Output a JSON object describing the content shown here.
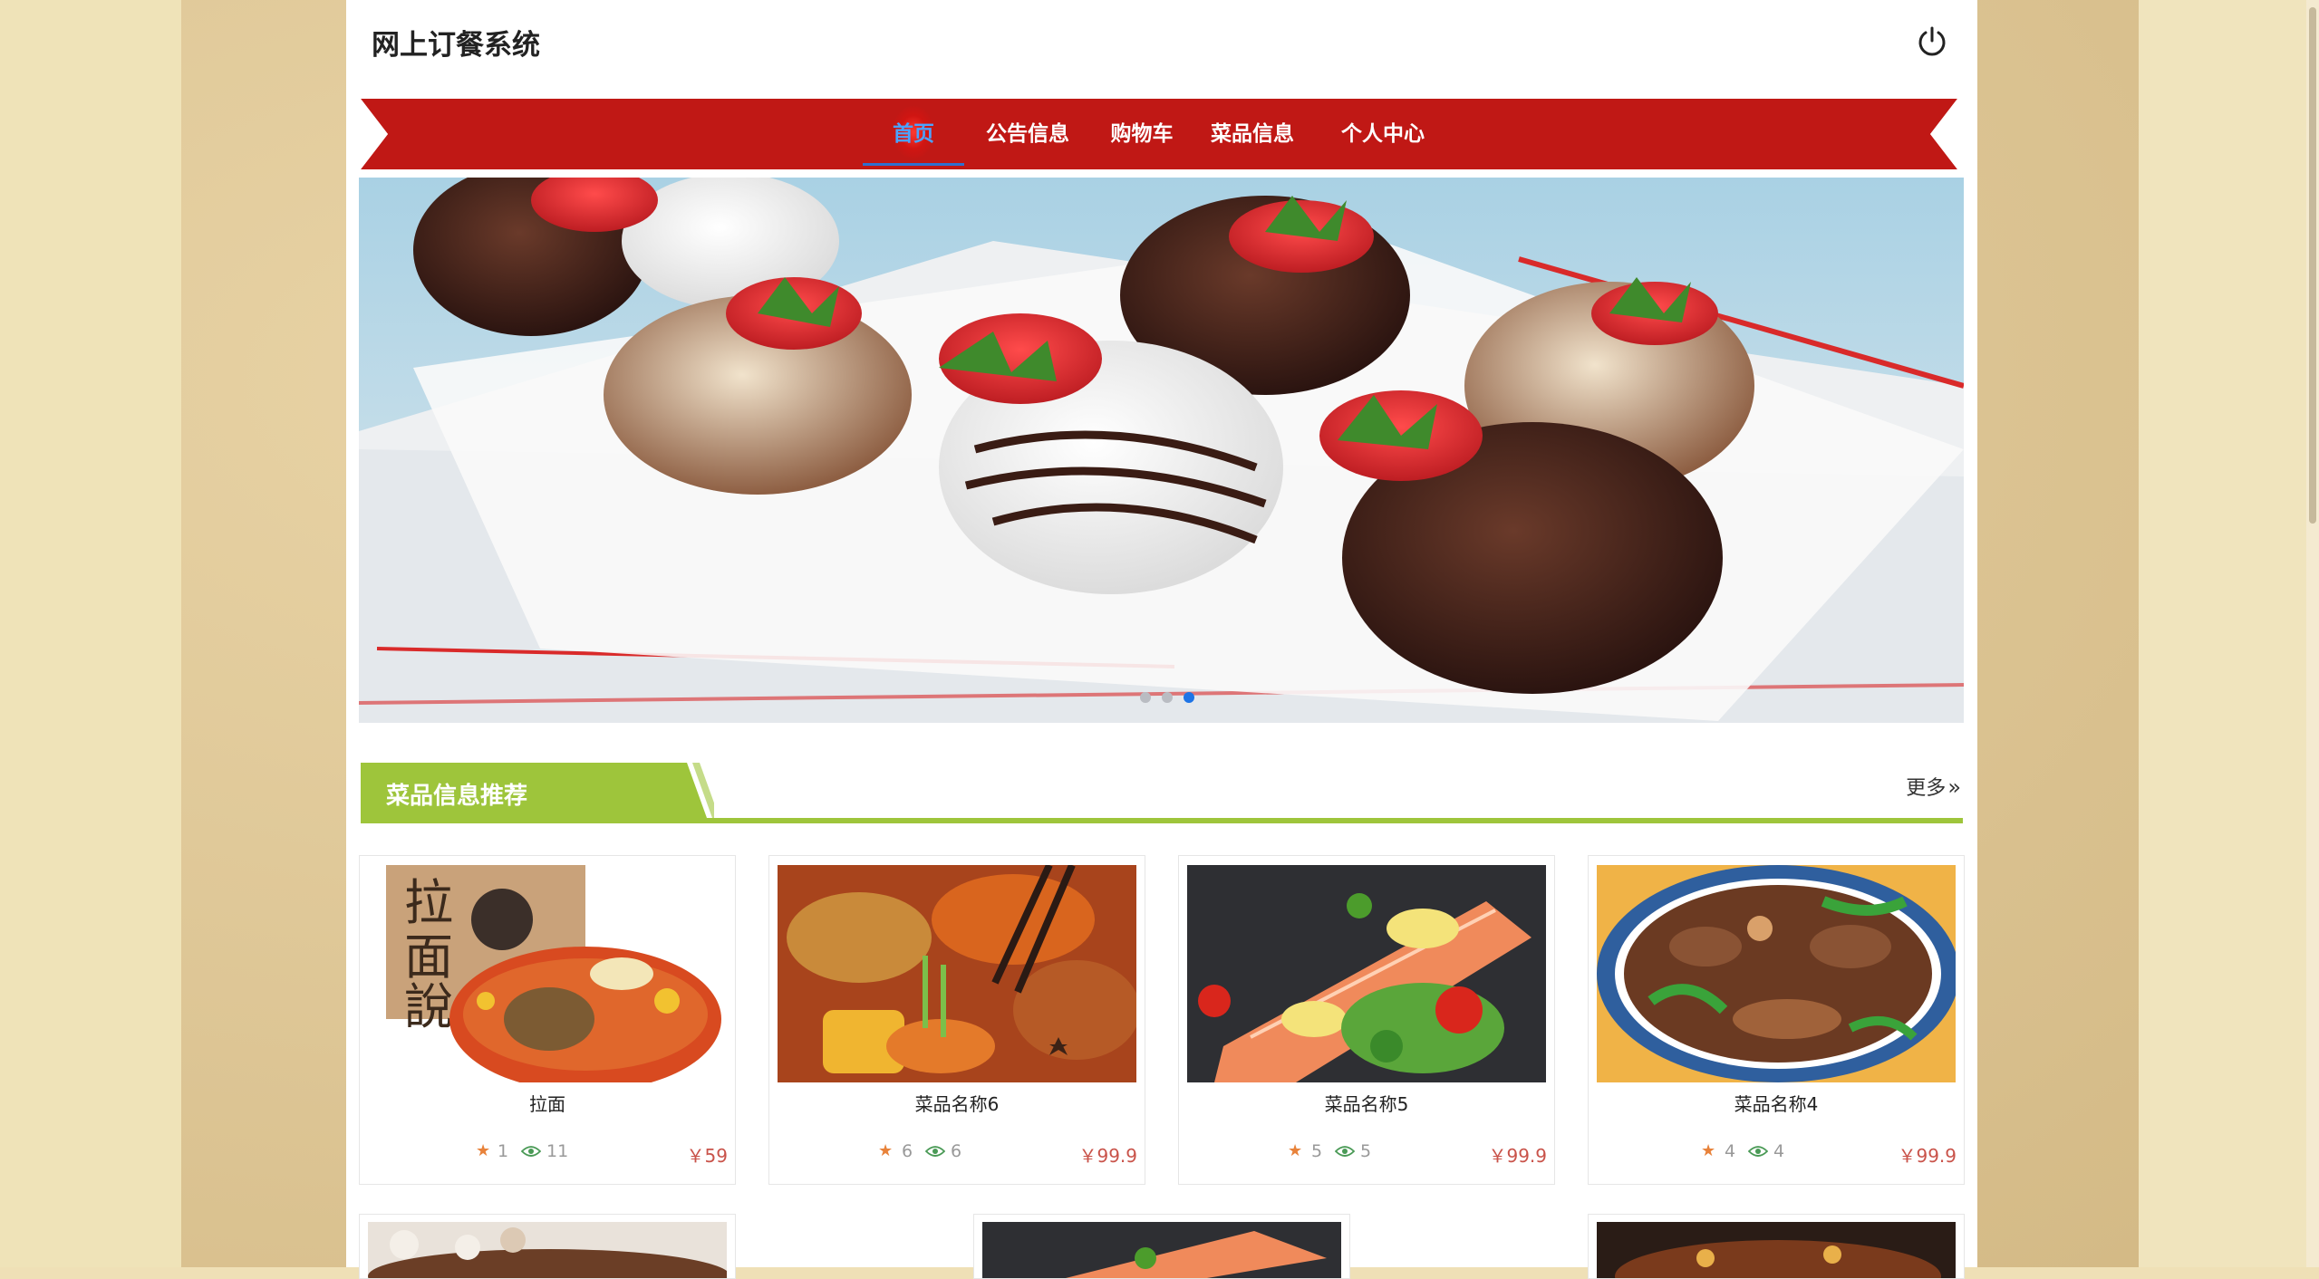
{
  "app": {
    "title": "网上订餐系统"
  },
  "nav": {
    "items": [
      {
        "label": "首页",
        "active": true
      },
      {
        "label": "公告信息",
        "active": false
      },
      {
        "label": "购物车",
        "active": false
      },
      {
        "label": "菜品信息",
        "active": false
      },
      {
        "label": "个人中心",
        "active": false
      }
    ]
  },
  "banner": {
    "slide_count": 3,
    "active_slide": 3
  },
  "section": {
    "title": "菜品信息推荐",
    "more_label": "更多",
    "more_icon": "double-chevron-right-icon"
  },
  "products": [
    {
      "name": "拉面",
      "likes": "1",
      "views": "11",
      "price": "￥59"
    },
    {
      "name": "菜品名称6",
      "likes": "6",
      "views": "6",
      "price": "￥99.9"
    },
    {
      "name": "菜品名称5",
      "likes": "5",
      "views": "5",
      "price": "￥99.9"
    },
    {
      "name": "菜品名称4",
      "likes": "4",
      "views": "4",
      "price": "￥99.9"
    }
  ],
  "colors": {
    "nav_red": "#c01815",
    "accent_green": "#9ec53b",
    "price": "#c9534a",
    "star": "#e8823a",
    "active_nav": "#4aa3ff"
  },
  "icons": {
    "power": "power-icon",
    "star": "star-icon",
    "view": "eye-icon"
  }
}
